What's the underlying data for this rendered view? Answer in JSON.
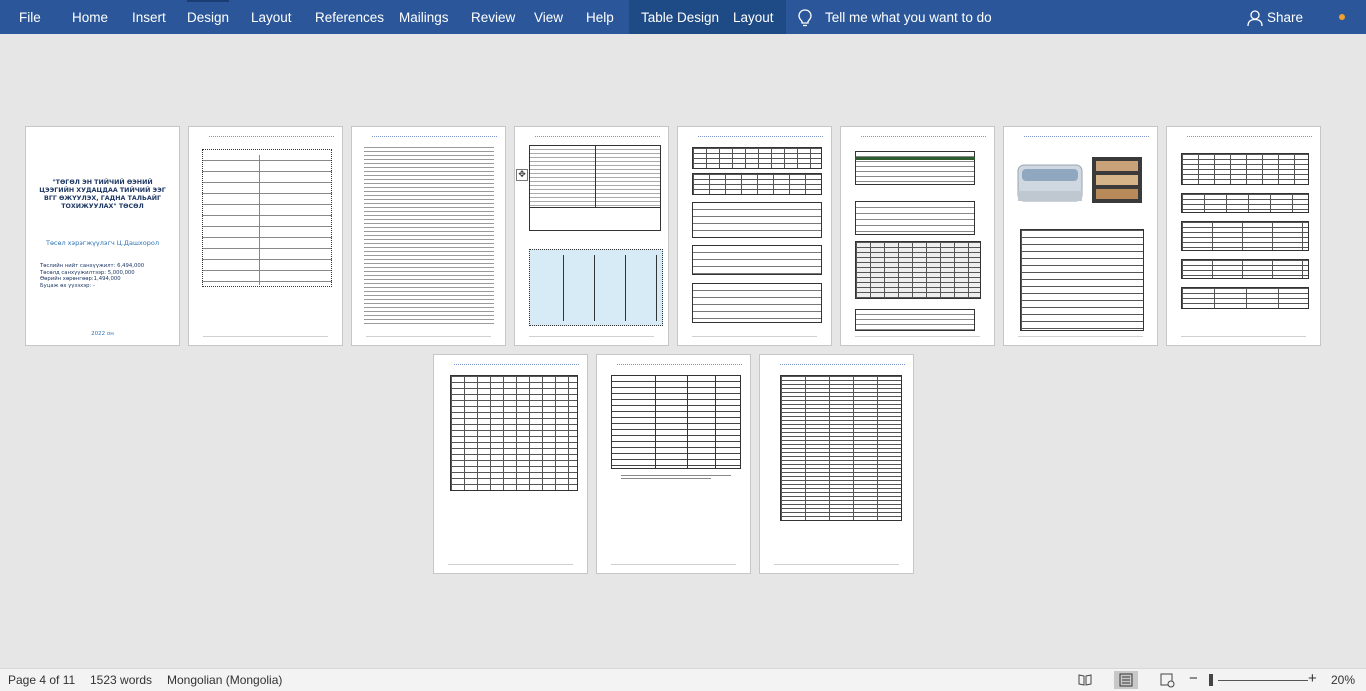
{
  "ribbon": {
    "tabs": [
      "File",
      "Home",
      "Insert",
      "Design",
      "Layout",
      "References",
      "Mailings",
      "Review",
      "View",
      "Help"
    ],
    "context_tabs": [
      "Table Design",
      "Layout"
    ],
    "tell_me": "Tell me what you want to do",
    "share": "Share",
    "accent": "#2b579a"
  },
  "cover": {
    "title": "\"ТӨГӨЛ ЭН ТИЙЧИЙ ӨЭНИЙ ЦЭЭГИЙН ХУДАЦДАА ТИЙЧИЙ ЭЭГ ВГГ ӨЖҮУЛЭХ, ГАДНА ТАЛЬАЙГ ТОХИЖУУЛАХ\" ТӨСӨЛ",
    "author": "Төсөл хэрэгжүүлэгч Ц.Дашхорол",
    "info": [
      "Төслийн нийт санхүүжилт: 6,494,000",
      "Төсөлд санхүүжилтээр: 5,000,000",
      "Өөрийн хөрөнгөөр:1,494,000",
      "Буцаж өх үүзэхэр:         -"
    ],
    "year": "2022 он"
  },
  "status": {
    "page": "Page 4 of 11",
    "words": "1523 words",
    "language": "Mongolian (Mongolia)",
    "zoom": "20%"
  }
}
